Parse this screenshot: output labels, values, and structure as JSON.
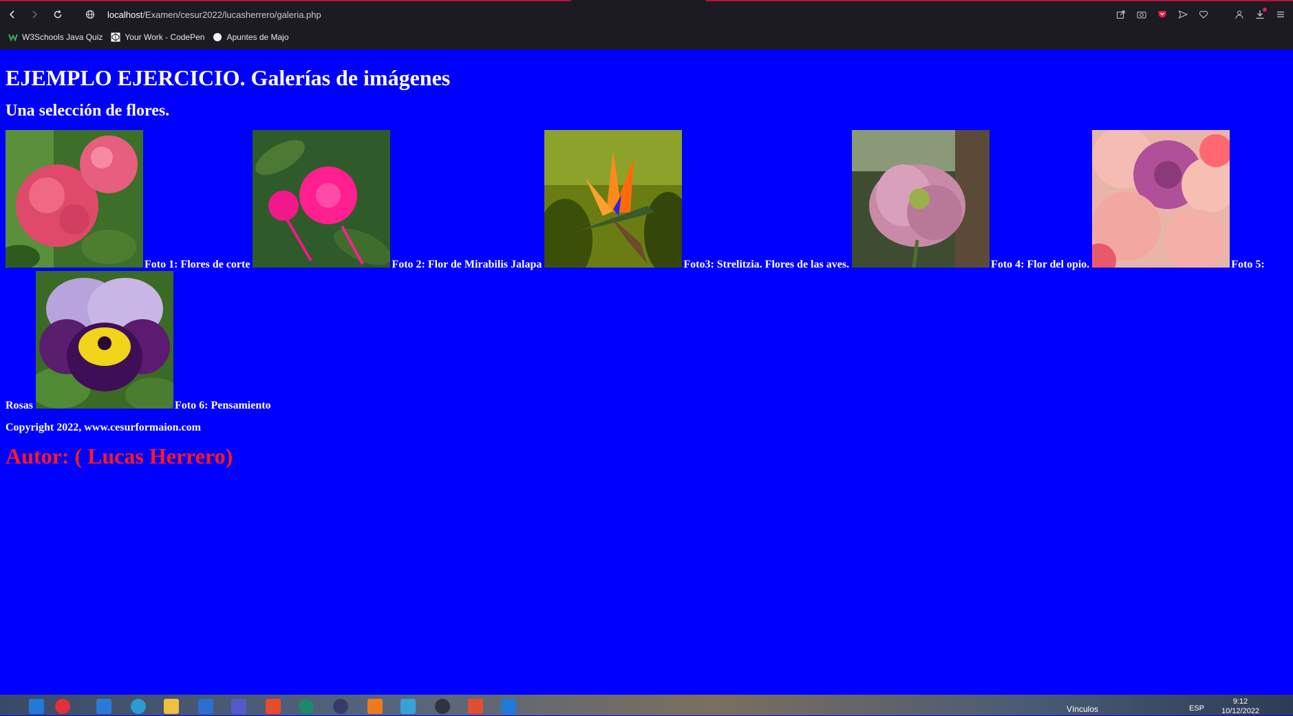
{
  "browser": {
    "url_host": "localhost",
    "url_path": "/Examen/cesur2022/lucasherrero/galeria.php",
    "bookmarks": [
      {
        "label": "W3Schools Java Quiz",
        "icon": "w3schools-icon"
      },
      {
        "label": "Your Work - CodePen",
        "icon": "codepen-icon"
      },
      {
        "label": "Apuntes de Majo",
        "icon": "circle-icon"
      }
    ]
  },
  "page": {
    "title": "EJEMPLO EJERCICIO. Galerías de imágenes",
    "subtitle": "Una selección de flores.",
    "photos": [
      {
        "caption": "Foto 1: Flores de corte",
        "subject": "pink hydrangea"
      },
      {
        "caption": "Foto 2: Flor de Mirabilis Jalapa",
        "subject": "magenta mirabilis"
      },
      {
        "caption": "Foto3: Strelitzia. Flores de las aves.",
        "subject": "bird of paradise"
      },
      {
        "caption": "Foto 4: Flor del opio.",
        "subject": "pink poppy"
      },
      {
        "caption": "Foto 5: Rosas",
        "subject": "roses"
      },
      {
        "caption": "Foto 6: Pensamiento",
        "subject": "pansy"
      }
    ],
    "copyright": "Copyright 2022, www.cesurformaion.com",
    "author": "Autor: ( Lucas Herrero)"
  },
  "taskbar": {
    "tray_label": "Vínculos",
    "language": "ESP",
    "time": "9:12",
    "date": "10/12/2022"
  },
  "colors": {
    "page_background": "#0000fe",
    "author_text": "#ff1a1a",
    "chrome_background": "#1c1b22"
  }
}
